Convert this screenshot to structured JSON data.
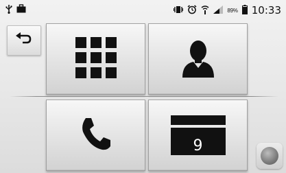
{
  "status_bar": {
    "battery_percent": "89%",
    "time": "10:33",
    "icons": [
      "usb-icon",
      "briefcase-icon",
      "vibrate-icon",
      "alarm-icon",
      "wifi-icon",
      "signal-icon",
      "battery-icon"
    ]
  },
  "buttons": {
    "back": {
      "icon": "back-arrow-icon"
    },
    "app_grid": {
      "icon": "grid-icon"
    },
    "contacts": {
      "icon": "person-icon"
    },
    "phone": {
      "icon": "phone-icon"
    },
    "calendar": {
      "icon": "calendar-icon",
      "day": "9"
    },
    "home": {
      "icon": "home-orb-icon"
    }
  }
}
